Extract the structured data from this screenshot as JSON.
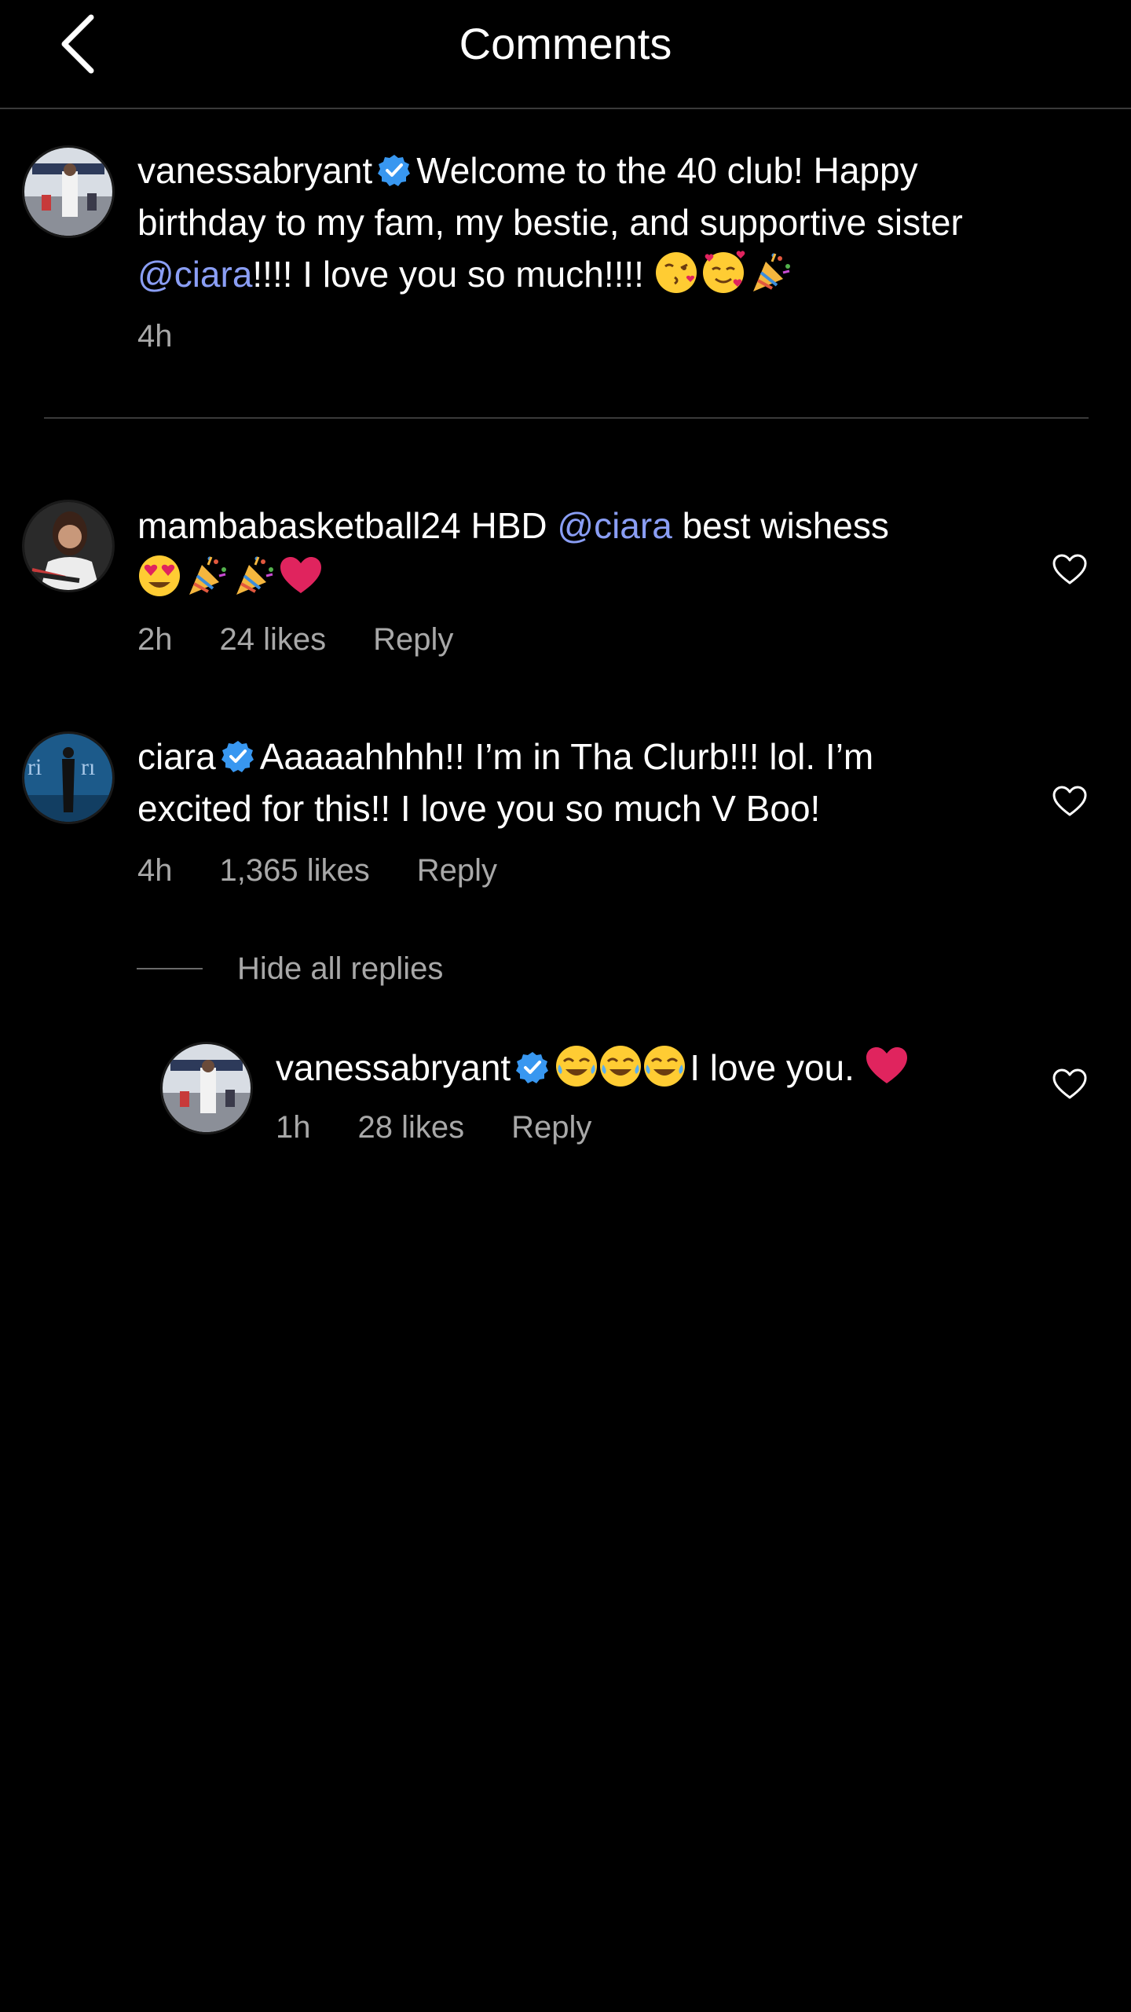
{
  "header": {
    "title": "Comments",
    "back_icon": "chevron-left-icon"
  },
  "caption": {
    "username": "vanessabryant",
    "verified": true,
    "text_line1": "Welcome to the 40 club! Happy",
    "text_line2": "birthday to my fam, my bestie, and supportive sister",
    "mention": "@ciara",
    "text_line3": "!!!! I love you so much!!!!",
    "emojis": [
      "kissing-face-icon",
      "smiling-face-with-hearts-icon",
      "party-popper-icon"
    ],
    "time": "4h"
  },
  "comments": [
    {
      "username": "mambabasketball24",
      "text_prefix": "HBD",
      "mention": "@ciara",
      "text_suffix": "best wishess",
      "emojis": [
        "heart-eyes-icon",
        "party-popper-icon",
        "party-popper-icon",
        "red-heart-icon"
      ],
      "time": "2h",
      "likes": "24 likes",
      "reply_label": "Reply"
    },
    {
      "username": "ciara",
      "verified": true,
      "text_line1": "Aaaaahhhh!! I’m in Tha Clurb!!! lol. I’m",
      "text_line2": "excited for this!! I love you so much V Boo!",
      "time": "4h",
      "likes": "1,365 likes",
      "reply_label": "Reply"
    }
  ],
  "hide_replies_label": "Hide all replies",
  "reply": {
    "username": "vanessabryant",
    "verified": true,
    "emojis_before": [
      "tears-of-joy-icon",
      "tears-of-joy-icon",
      "tears-of-joy-icon"
    ],
    "text": "I love you.",
    "emoji_after": "red-heart-icon",
    "time": "1h",
    "likes": "28 likes",
    "reply_label": "Reply"
  },
  "colors": {
    "background": "#000000",
    "text": "#ffffff",
    "meta": "#a8a8a8",
    "mention": "#8a9ef5",
    "verified": "#3897f0",
    "divider": "#3a3a3a"
  }
}
